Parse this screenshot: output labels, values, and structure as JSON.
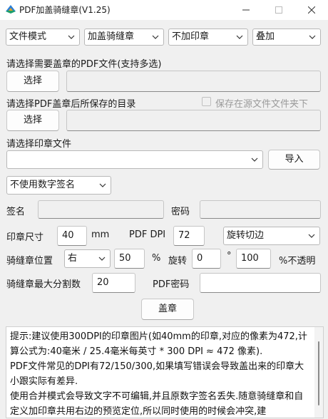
{
  "window": {
    "title": "PDF加盖骑缝章(V1.25)"
  },
  "mode_selects": [
    {
      "value": "文件模式"
    },
    {
      "value": "加盖骑缝章"
    },
    {
      "value": "不加印章"
    },
    {
      "value": "叠加"
    }
  ],
  "source": {
    "prompt": "请选择需要盖章的PDF文件(支持多选)",
    "button": "选择",
    "path": ""
  },
  "output": {
    "prompt": "请选择PDF盖章后所保存的目录",
    "button": "选择",
    "path": "",
    "save_in_source_label": "保存在源文件文件夹下",
    "save_in_source_checked": false
  },
  "stamp": {
    "prompt": "请选择印章文件",
    "file": "",
    "import_button": "导入"
  },
  "signature": {
    "select_value": "不使用数字签名",
    "sign_label": "签名",
    "sign_value": "",
    "password_label": "密码",
    "password_value": ""
  },
  "size": {
    "label": "印章尺寸",
    "value": "40",
    "unit": "mm",
    "dpi_label": "PDF DPI",
    "dpi_value": "72",
    "rotate_mode": "旋转切边"
  },
  "seam": {
    "position_label": "骑缝章位置",
    "position_value": "右",
    "percent_value": "50",
    "percent_unit": "%",
    "rotate_label": "旋转",
    "rotate_value": "0",
    "degree_unit": "°",
    "opacity_value": "100",
    "opacity_unit": "%不透明"
  },
  "split": {
    "label": "骑缝章最大分割数",
    "value": "20",
    "pdf_password_label": "PDF密码",
    "pdf_password_value": ""
  },
  "stamp_button": "盖章",
  "tips": "提示:建议使用300DPI的印章图片(如40mm的印章,对应的像素为472,计算公式为:40毫米 / 25.4毫米每英寸 * 300 DPI ≈ 472 像素).\nPDF文件常见的DPI有72/150/300,如果填写错误会导致盖出来的印章大小跟实际有差异.\n使用合并模式会导致文字不可编辑,并且原数字签名丢失.随意骑缝章和自定义加印章共用右边的预览定位,所以同时使用的时候会冲突,建"
}
